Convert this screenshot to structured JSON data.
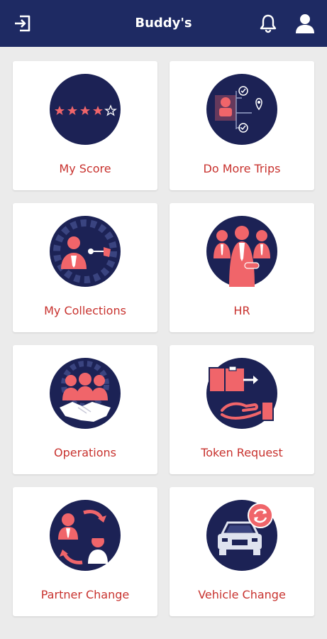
{
  "appbar": {
    "title": "Buddy's",
    "icons": {
      "left": "logout-icon",
      "bell": "notification-bell-icon",
      "profile": "profile-icon"
    }
  },
  "colors": {
    "header": "#1e2a63",
    "navy": "#1c2255",
    "accent": "#f0656a",
    "label": "#c8322e",
    "background": "#ebebeb"
  },
  "tiles": [
    {
      "label": "My Score",
      "icon": "star-rating-icon"
    },
    {
      "label": "Do More Trips",
      "icon": "trips-route-icon"
    },
    {
      "label": "My Collections",
      "icon": "collections-icon"
    },
    {
      "label": "HR",
      "icon": "hr-team-icon"
    },
    {
      "label": "Operations",
      "icon": "operations-handshake-icon"
    },
    {
      "label": "Token Request",
      "icon": "token-request-icon"
    },
    {
      "label": "Partner Change",
      "icon": "partner-change-icon"
    },
    {
      "label": "Vehicle Change",
      "icon": "vehicle-change-icon"
    }
  ]
}
